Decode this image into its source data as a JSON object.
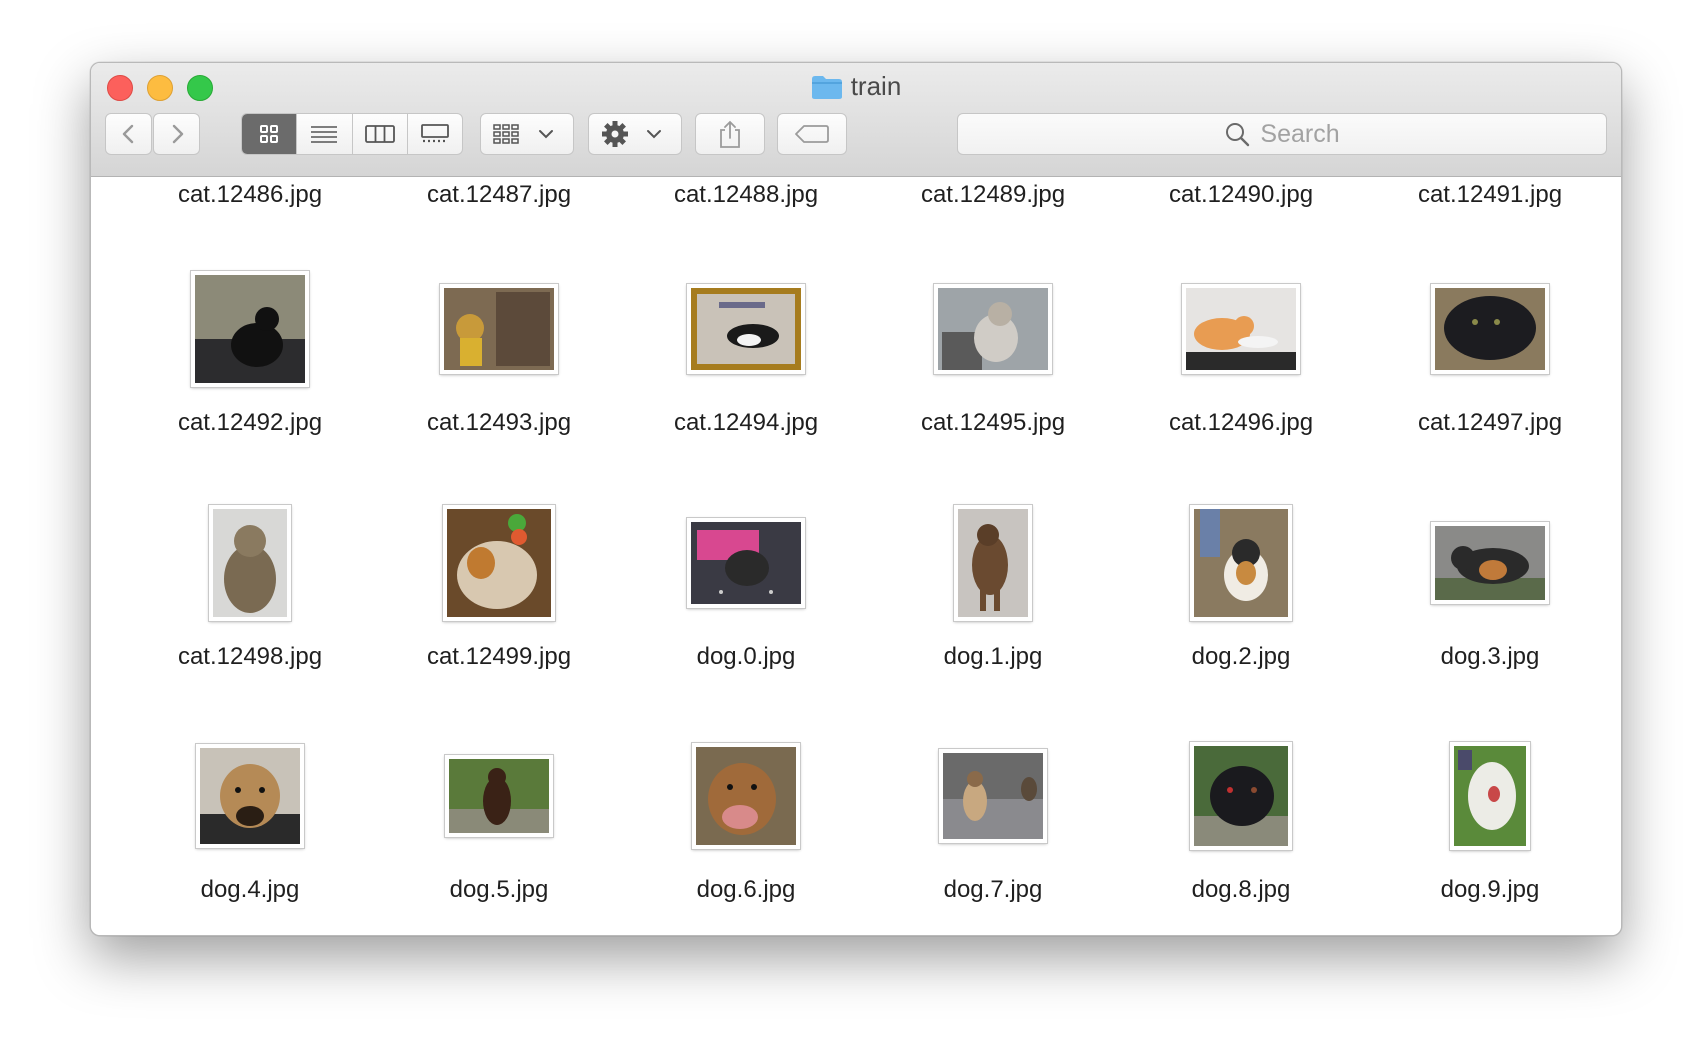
{
  "window": {
    "title": "train"
  },
  "toolbar": {
    "search_placeholder": "Search"
  },
  "top_row": [
    "cat.12486.jpg",
    "cat.12487.jpg",
    "cat.12488.jpg",
    "cat.12489.jpg",
    "cat.12490.jpg",
    "cat.12491.jpg"
  ],
  "files": [
    {
      "name": "cat.12492.jpg"
    },
    {
      "name": "cat.12493.jpg"
    },
    {
      "name": "cat.12494.jpg"
    },
    {
      "name": "cat.12495.jpg"
    },
    {
      "name": "cat.12496.jpg"
    },
    {
      "name": "cat.12497.jpg"
    },
    {
      "name": "cat.12498.jpg"
    },
    {
      "name": "cat.12499.jpg"
    },
    {
      "name": "dog.0.jpg"
    },
    {
      "name": "dog.1.jpg"
    },
    {
      "name": "dog.2.jpg"
    },
    {
      "name": "dog.3.jpg"
    },
    {
      "name": "dog.4.jpg"
    },
    {
      "name": "dog.5.jpg"
    },
    {
      "name": "dog.6.jpg"
    },
    {
      "name": "dog.7.jpg"
    },
    {
      "name": "dog.8.jpg"
    },
    {
      "name": "dog.9.jpg"
    }
  ],
  "colors": {
    "close": "#fc605c",
    "minimize": "#fdbc40",
    "maximize": "#34c84a",
    "folder": "#6cb8ee",
    "active_view": "#6b6b6b"
  }
}
